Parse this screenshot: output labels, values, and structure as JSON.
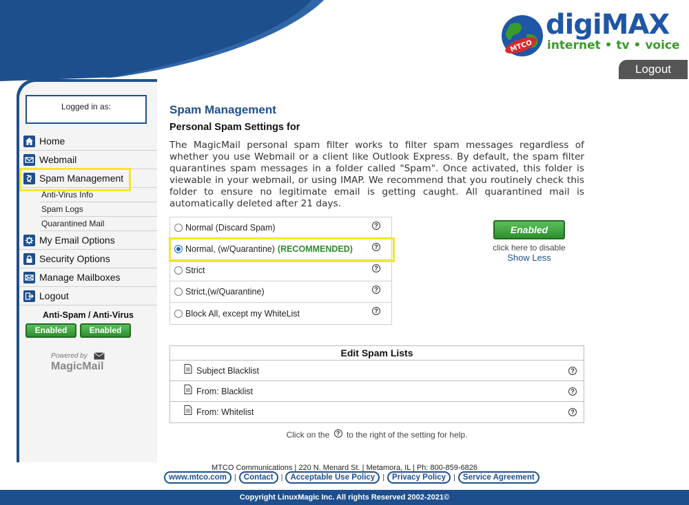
{
  "colors": {
    "brand_blue": "#1e4f8d",
    "green": "#2e8b2e",
    "highlight": "#f5e62a",
    "logout_tab": "#555555"
  },
  "header": {
    "logo_globe_text": "MTCO",
    "logo_brand_a": "digi",
    "logo_brand_b": "MAX",
    "logo_tagline": "internet • tv • voice",
    "logout_label": "Logout"
  },
  "sidebar": {
    "logged_in_label": "Logged in as:",
    "nav": [
      {
        "label": "Home",
        "icon": "home-icon"
      },
      {
        "label": "Webmail",
        "icon": "envelope-icon"
      },
      {
        "label": "Spam Management",
        "icon": "spam-icon"
      }
    ],
    "sub_items": [
      "Anti-Virus Info",
      "Spam Logs",
      "Quarantined Mail"
    ],
    "nav2": [
      {
        "label": "My Email Options",
        "icon": "gear-icon"
      },
      {
        "label": "Security Options",
        "icon": "lock-icon"
      },
      {
        "label": "Manage Mailboxes",
        "icon": "envelope-icon"
      },
      {
        "label": "Logout",
        "icon": "logout-icon"
      }
    ],
    "antispam_title": "Anti-Spam / Anti-Virus",
    "antispam_btn": "Enabled",
    "antivirus_btn": "Enabled",
    "powered_by": "Powered by",
    "magicmail": "MagicMail"
  },
  "main": {
    "title": "Spam Management",
    "subtitle": "Personal Spam Settings for",
    "description": "The MagicMail personal spam filter works to filter spam messages regardless of whether you use Webmail or a client like Outlook Express. By default, the spam filter quarantines spam messages in a folder called \"Spam\". Once activated, this folder is viewable in your webmail, or using IMAP. We recommend that you routinely check this folder to ensure no legitimate email is getting caught. All quarantined mail is automatically deleted after 21 days.",
    "options": [
      {
        "label": "Normal (Discard Spam)",
        "extra": ""
      },
      {
        "label": "Normal, (w/Quarantine)",
        "extra": "(RECOMMENDED)"
      },
      {
        "label": "Strict",
        "extra": ""
      },
      {
        "label": "Strict,(w/Quarantine)",
        "extra": ""
      },
      {
        "label": "Block All, except my WhiteList",
        "extra": ""
      }
    ],
    "selected_option": "Normal, (w/Quarantine)",
    "help_glyph": "?",
    "status_btn": "Enabled",
    "disable_note": "click here to disable",
    "show_less": "Show Less",
    "lists_title": "Edit Spam Lists",
    "lists": [
      "Subject Blacklist",
      "From: Blacklist",
      "From: Whitelist"
    ],
    "help_note_a": "Click on the",
    "help_note_b": "to the right of the setting for help."
  },
  "footer": {
    "address": "MTCO Communications | 220 N. Menard St. | Metamora, IL | Ph: 800-859-6826",
    "links": [
      "www.mtco.com",
      "Contact",
      "Acceptable Use Policy",
      "Privacy Policy",
      "Service Agreement"
    ],
    "separator": "|",
    "copyright": "Copyright LinuxMagic Inc. All rights Reserved 2002-2021©"
  }
}
